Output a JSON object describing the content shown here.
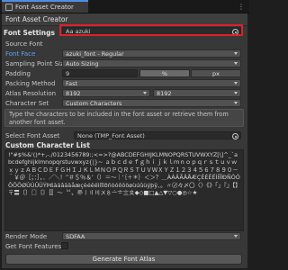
{
  "window": {
    "tab_title": "Font Asset Creator",
    "header": "Font Asset Creator"
  },
  "section_title": "Font Settings",
  "fields": {
    "source_font_label": "Source Font",
    "source_font_value": "Aa azuki",
    "font_face_label": "Font Face",
    "font_face_value": "azuki_font - Regular",
    "sampling_label": "Sampling Point Size",
    "sampling_value": "Auto Sizing",
    "padding_label": "Padding",
    "padding_value": "9",
    "padding_mode_percent": "%",
    "padding_mode_px": "px",
    "packing_label": "Packing Method",
    "packing_value": "Fast",
    "atlas_label": "Atlas Resolution",
    "atlas_w": "8192",
    "atlas_h": "8192",
    "charset_label": "Character Set",
    "charset_value": "Custom Characters"
  },
  "info_text": "Type the characters to be included in the font asset or retrieve them from another font asset.",
  "select_font_label": "Select Font Asset",
  "select_font_value": "None (TMP_Font Asset)",
  "custom_list_title": "Custom Character List",
  "custom_chars": "!\"#$%&'()*+,-./0123456789:;<=>?@ABCDEFGHIJKLMNOPQRSTUVWXYZ[\\]^_`abcdefghijklmnopqrstuvwxyz{|}~ ａｂｃｄｅｆｇｈｉｊｋｌｍｎｏｐｑｒｓｔｕｖｗｘｙｚＡＢＣＤＥＦＧＨＩＪＫＬＭＮＯＰＱＲＳＴＵＶＷＸＹＺ１２３４５６７８９０－＾￥＠［；：］，．／＼！”＃＄％＆’（）＝～｜‘｛＋＊｝＜＞？＿ÀÁÂÃÄÅÆÇÈÉÊËÌÍÎÏÐÑÒÓÔÕÖØÙÚÛÜÝÞßàáâãäåæçèéêëìíîïðñòóôõöøùúûüýþÿ、。〃〄々〆〇〈〉《》「」『』【】〒〓〔〕〖〗〘〙〚〛〜〝〞〟〠〡〢〣〤〥〦〧〨〩◆◇■□▲△▼▽○●◎☆★",
  "render_mode_label": "Render Mode",
  "render_mode_value": "SDFAA",
  "get_features_label": "Get Font Features",
  "generate_button": "Generate Font Atlas"
}
